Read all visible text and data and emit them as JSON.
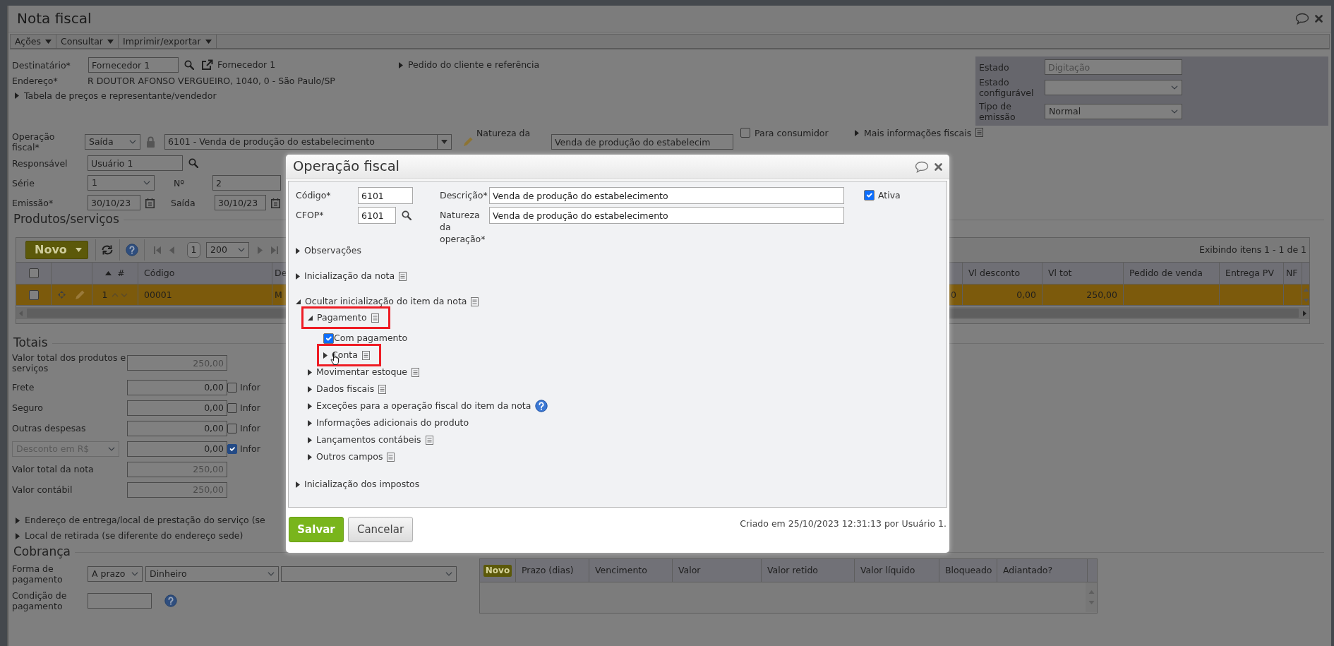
{
  "window": {
    "title": "Nota fiscal"
  },
  "menu": [
    {
      "label": "Ações"
    },
    {
      "label": "Consultar"
    },
    {
      "label": "Imprimir/exportar"
    }
  ],
  "recipient": {
    "label": "Destinatário*",
    "value": "Fornecedor 1",
    "link": "Fornecedor 1"
  },
  "customer_order_link": "Pedido do cliente e referência",
  "address": {
    "label": "Endereço*",
    "value": "R DOUTOR AFONSO VERGUEIRO, 1040, 0 - São Paulo/SP"
  },
  "price_table_link": "Tabela de preços e representante/vendedor",
  "status_panel": [
    {
      "label": "Estado",
      "kind": "readonly",
      "value": "Digitação"
    },
    {
      "label": "Estado configurável",
      "kind": "select"
    },
    {
      "label": "Tipo de emissão",
      "kind": "select",
      "value": "Normal"
    }
  ],
  "operation": {
    "label": "Operação fiscal*",
    "direction": "Saída",
    "value": "6101 - Venda de produção do estabelecimento",
    "nature_label": "Natureza da",
    "nature_value": "Venda de produção do estabelecim",
    "final_consumer": {
      "label": "Para consumidor",
      "checked": false
    },
    "more_link": "Mais informações fiscais"
  },
  "responsible": {
    "label": "Responsável",
    "value": "Usuário 1"
  },
  "series": {
    "label": "Série",
    "value": "1",
    "number_label": "Nº",
    "number_value": "2"
  },
  "dates": {
    "issue_label": "Emissão*",
    "issue": "30/10/23",
    "exit_label": "Saída",
    "exit": "30/10/23"
  },
  "products": {
    "title": "Produtos/serviços",
    "new_button": "Novo",
    "page": "1",
    "page_size": "200",
    "summary": "Exibindo itens 1 - 1 de 1",
    "select_all_checked": false,
    "columns": [
      {
        "kind": "text",
        "label": "#",
        "sorted": true
      },
      {
        "kind": "text",
        "label": "Código",
        "sorted": false
      },
      {
        "kind": "text",
        "label": "De",
        "sorted": false
      },
      {
        "kind": "blank"
      },
      {
        "kind": "text",
        "label": "Vl desconto",
        "sorted": false
      },
      {
        "kind": "text",
        "label": "Vl tot",
        "sorted": false
      },
      {
        "kind": "text",
        "label": "Pedido de venda",
        "sorted": false
      },
      {
        "kind": "text",
        "label": "Entrega PV",
        "sorted": false
      },
      {
        "kind": "text",
        "label": "NF",
        "sorted": false
      }
    ],
    "rows": [
      {
        "selected": true,
        "checked": false,
        "cells": [
          "1",
          "00001",
          "M",
          "0",
          "0,00",
          "250,00"
        ]
      }
    ]
  },
  "totals": {
    "title": "Totais",
    "rows": [
      {
        "kind": "field",
        "label": "Valor total dos produtos e serviços",
        "value": "250,00",
        "readonly": true
      },
      {
        "kind": "field",
        "label": "Frete",
        "value": "0,00",
        "readonly": false,
        "option": {
          "label": "Infor",
          "checked": false
        }
      },
      {
        "kind": "field",
        "label": "Seguro",
        "value": "0,00",
        "readonly": false,
        "option": {
          "label": "Infor",
          "checked": false
        }
      },
      {
        "kind": "field",
        "label": "Outras despesas",
        "value": "0,00",
        "readonly": false,
        "option": {
          "label": "Infor",
          "checked": false
        }
      },
      {
        "kind": "select",
        "selector": "Desconto em R$",
        "disabled": true,
        "value": "0,00",
        "readonly": false,
        "option": {
          "label": "Infor",
          "checked": true
        }
      },
      {
        "kind": "field",
        "label": "Valor total da nota",
        "value": "250,00",
        "readonly": true
      },
      {
        "kind": "field",
        "label": "Valor contábil",
        "value": "250,00",
        "readonly": true
      }
    ]
  },
  "delivery_link": "Endereço de entrega/local de prestação do serviço (se",
  "pickup_link": "Local de retirada (se diferente do endereço sede)",
  "billing": {
    "title": "Cobrança",
    "payment_label": "Forma de pagamento",
    "term": "A prazo",
    "method": "Dinheiro",
    "condition_label": "Condição de pagamento",
    "grid": {
      "new_button": "Novo",
      "columns": [
        "Prazo (dias)",
        "Vencimento",
        "Valor",
        "Valor retido",
        "Valor líquido",
        "Bloqueado",
        "Adiantado?"
      ]
    }
  },
  "modal": {
    "title": "Operação fiscal",
    "fields": [
      {
        "label": "Código*",
        "value": "6101",
        "kind": "text"
      },
      {
        "label": "Descrição*",
        "value": "Venda de produção do estabelecimento",
        "kind": "text"
      },
      {
        "label": "CFOP*",
        "value": "6101",
        "kind": "lookup"
      },
      {
        "label": "Natureza da operação*",
        "value": "Venda de produção do estabelecimento",
        "kind": "text"
      }
    ],
    "active": {
      "label": "Ativa",
      "checked": true
    },
    "tree": [
      {
        "kind": "section",
        "label": "Observações",
        "expanded": false,
        "highlighted": false
      },
      {
        "kind": "documented",
        "label": "Inicialização da nota",
        "expanded": false,
        "highlighted": false
      },
      {
        "kind": "documented",
        "label": "Ocultar inicialização do item da nota",
        "expanded": true,
        "highlighted": false,
        "children": [
          {
            "kind": "documented",
            "label": "Pagamento",
            "expanded": true,
            "highlighted": true,
            "children": [
              {
                "kind": "checkbox",
                "label": "Com pagamento",
                "checked": true
              },
              {
                "kind": "documented",
                "label": "Conta",
                "expanded": false,
                "highlighted": true,
                "pointer": true
              }
            ]
          },
          {
            "kind": "documented",
            "label": "Movimentar estoque",
            "expanded": false,
            "highlighted": false
          },
          {
            "kind": "documented",
            "label": "Dados fiscais",
            "expanded": false,
            "highlighted": false
          },
          {
            "kind": "help",
            "label": "Exceções para a operação fiscal do item da nota",
            "expanded": false,
            "highlighted": false
          },
          {
            "kind": "section",
            "label": "Informações adicionais do produto",
            "expanded": false,
            "highlighted": false
          },
          {
            "kind": "documented",
            "label": "Lançamentos contábeis",
            "expanded": false,
            "highlighted": false
          },
          {
            "kind": "documented",
            "label": "Outros campos",
            "expanded": false,
            "highlighted": false
          }
        ]
      },
      {
        "kind": "section",
        "label": "Inicialização dos impostos",
        "expanded": false,
        "highlighted": false
      }
    ],
    "buttons": [
      {
        "label": "Salvar",
        "kind": "primary"
      },
      {
        "label": "Cancelar",
        "kind": "secondary"
      }
    ],
    "footer_note": "Criado em 25/10/2023 12:31:13 por Usuário 1."
  }
}
